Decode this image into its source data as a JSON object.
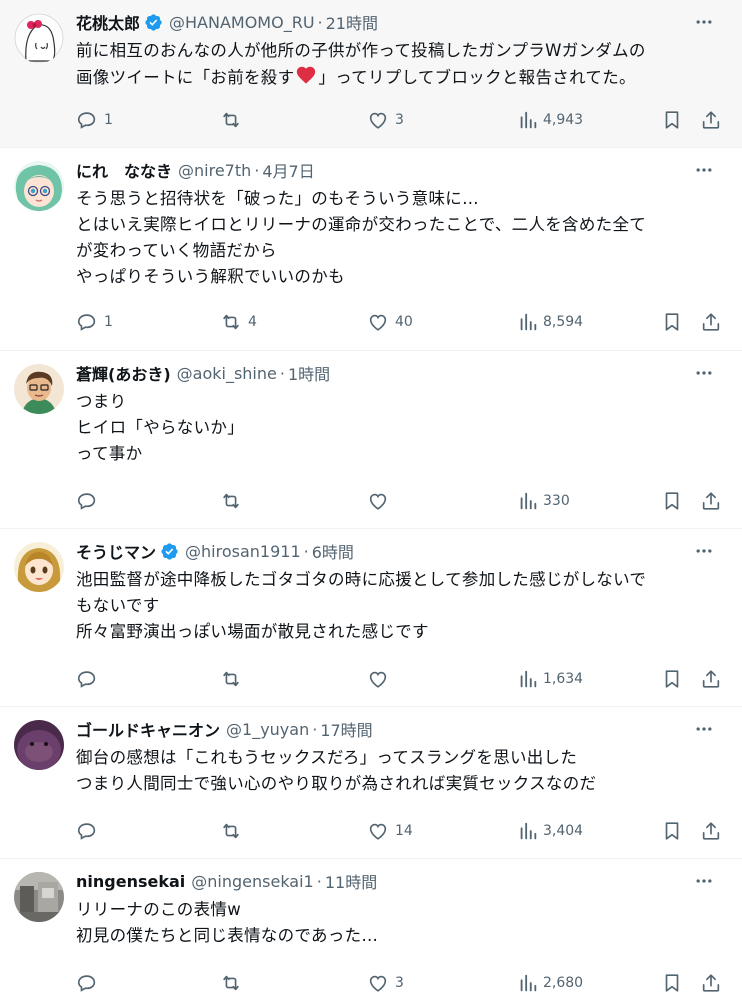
{
  "tweets": [
    {
      "name": "花桃太郎",
      "handle": "@HANAMOMO_RU",
      "sep": "·",
      "time": "21時間",
      "lines": [
        "前に相互のおんなの人が他所の子供が作って投稿したガンプラWガンダムの",
        "画像ツイートに「お前を殺す",
        "」ってリプしてブロックと報告されてた。"
      ],
      "reply_count": "1",
      "retweet_count": "",
      "like_count": "3",
      "view_count": "4,943"
    },
    {
      "name": "にれ　ななき",
      "handle": "@nire7th",
      "sep": "·",
      "time": "4月7日",
      "lines": [
        "そう思うと招待状を「破った」のもそういう意味に…",
        "とはいえ実際ヒイロとリリーナの運命が交わったことで、二人を含めた全て",
        "が変わっていく物語だから",
        "やっぱりそういう解釈でいいのかも"
      ],
      "reply_count": "1",
      "retweet_count": "4",
      "like_count": "40",
      "view_count": "8,594"
    },
    {
      "name": "蒼輝(あおき)",
      "handle": "@aoki_shine",
      "sep": "·",
      "time": "1時間",
      "lines": [
        "つまり",
        "ヒイロ「やらないか」",
        "って事か"
      ],
      "reply_count": "",
      "retweet_count": "",
      "like_count": "",
      "view_count": "330"
    },
    {
      "name": "そうじマン",
      "handle": "@hirosan1911",
      "sep": "·",
      "time": "6時間",
      "lines": [
        "池田監督が途中降板したゴタゴタの時に応援として参加した感じがしないで",
        "もないです",
        "所々富野演出っぽい場面が散見された感じです"
      ],
      "reply_count": "",
      "retweet_count": "",
      "like_count": "",
      "view_count": "1,634"
    },
    {
      "name": "ゴールドキャニオン",
      "handle": "@1_yuyan",
      "sep": "·",
      "time": "17時間",
      "lines": [
        "御台の感想は「これもうセックスだろ」ってスラングを思い出した",
        "つまり人間同士で強い心のやり取りが為されれば実質セックスなのだ"
      ],
      "reply_count": "",
      "retweet_count": "",
      "like_count": "14",
      "view_count": "3,404"
    },
    {
      "name": "ningensekai",
      "handle": "@ningensekai1",
      "sep": "·",
      "time": "11時間",
      "lines": [
        "リリーナのこの表情w",
        "初見の僕たちと同じ表情なのであった…"
      ],
      "reply_count": "",
      "retweet_count": "",
      "like_count": "3",
      "view_count": "2,680"
    }
  ]
}
